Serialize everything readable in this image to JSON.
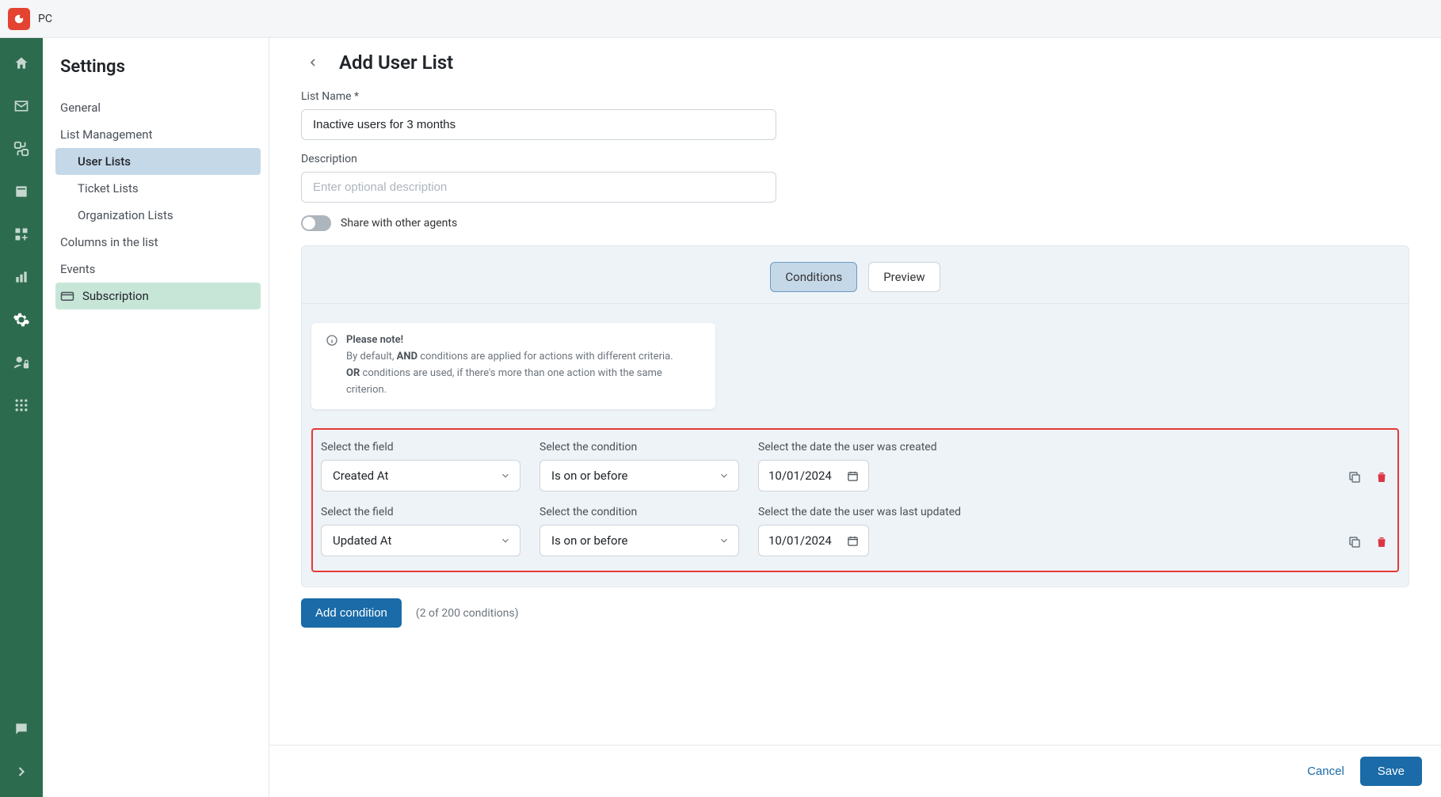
{
  "workspace": "PC",
  "sidebar": {
    "title": "Settings",
    "items": {
      "general": "General",
      "list_management": "List Management",
      "user_lists": "User Lists",
      "ticket_lists": "Ticket Lists",
      "organization_lists": "Organization Lists",
      "columns": "Columns in the list",
      "events": "Events",
      "subscription": "Subscription"
    }
  },
  "page": {
    "title": "Add User List",
    "list_name_label": "List Name *",
    "list_name_value": "Inactive users for 3 months",
    "description_label": "Description",
    "description_placeholder": "Enter optional description",
    "share_label": "Share with other agents"
  },
  "tabs": {
    "conditions": "Conditions",
    "preview": "Preview"
  },
  "note": {
    "title": "Please note!",
    "line1a": "By default, ",
    "line1b": "AND",
    "line1c": " conditions are applied for actions with different criteria.",
    "line2a": "OR",
    "line2b": " conditions are used, if there's more than one action with the same criterion."
  },
  "conditions": [
    {
      "field_label": "Select the field",
      "field_value": "Created At",
      "condition_label": "Select the condition",
      "condition_value": "Is on or before",
      "date_label": "Select the date the user was created",
      "date_value": "10/01/2024"
    },
    {
      "field_label": "Select the field",
      "field_value": "Updated At",
      "condition_label": "Select the condition",
      "condition_value": "Is on or before",
      "date_label": "Select the date the user was last updated",
      "date_value": "10/01/2024"
    }
  ],
  "add_condition": "Add condition",
  "count_text": "(2 of 200 conditions)",
  "footer": {
    "cancel": "Cancel",
    "save": "Save"
  }
}
